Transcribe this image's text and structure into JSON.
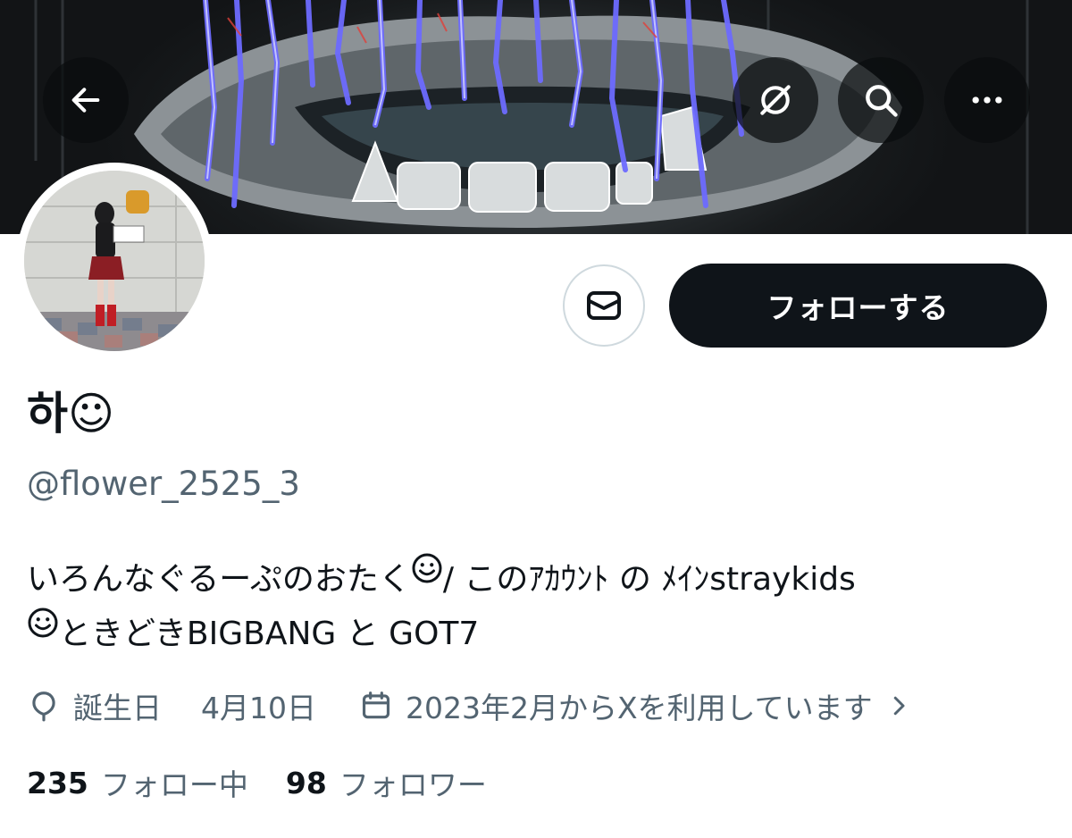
{
  "header": {
    "back_icon": "arrow-left-icon",
    "grok_icon": "grok-icon",
    "search_icon": "search-icon",
    "more_icon": "more-horizontal-icon"
  },
  "profile": {
    "display_name": "하☺",
    "handle": "@flower_2525_3",
    "bio_line1": "いろんなぐるーぷのおたく",
    "bio_line1b": "/ このｱｶｳﾝﾄ の ﾒｲﾝstraykids",
    "bio_line2": "ときどきBIGBANG と GOT7",
    "birthday_label": "誕生日",
    "birthday_value": "4月10日",
    "joined": "2023年2月からXを利用しています",
    "following_count": "235",
    "following_label": "フォロー中",
    "followers_count": "98",
    "followers_label": "フォロワー"
  },
  "actions": {
    "follow_label": "フォローする",
    "message_icon": "envelope-icon"
  },
  "colors": {
    "text_primary": "#0f1419",
    "text_secondary": "#536471",
    "button_dark": "#0f1419",
    "border": "#cfd9de"
  }
}
